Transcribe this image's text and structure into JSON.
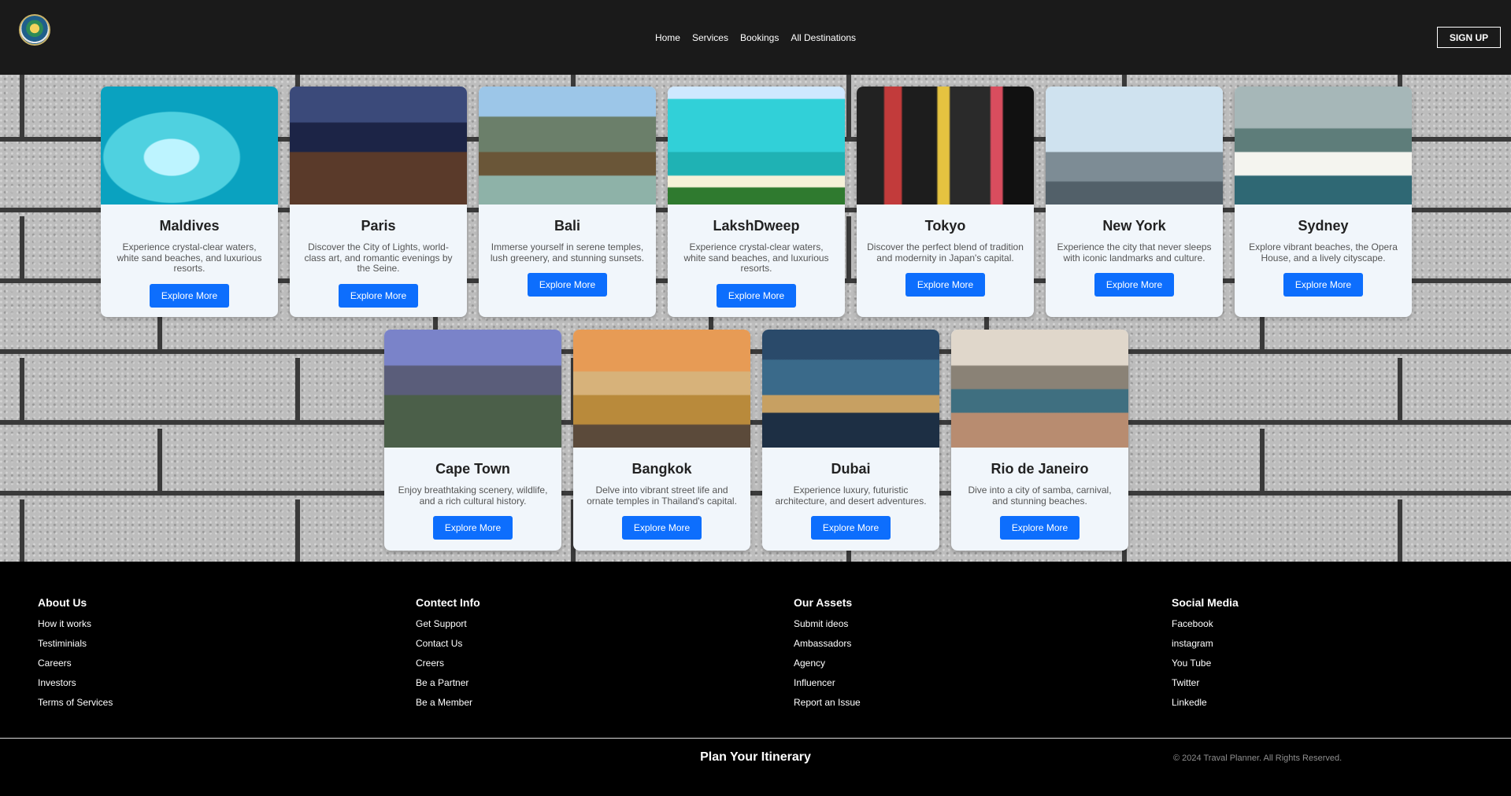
{
  "header": {
    "logo_alt": "logo",
    "nav": [
      "Home",
      "Services",
      "Bookings",
      "All Destinations"
    ],
    "signup": "SIGN UP"
  },
  "destinations": [
    {
      "name": "Maldives",
      "desc": "Experience crystal-clear waters, white sand beaches, and luxurious resorts.",
      "button": "Explore More"
    },
    {
      "name": "Paris",
      "desc": "Discover the City of Lights, world-class art, and romantic evenings by the Seine.",
      "button": "Explore More"
    },
    {
      "name": "Bali",
      "desc": "Immerse yourself in serene temples, lush greenery, and stunning sunsets.",
      "button": "Explore More"
    },
    {
      "name": "LakshDweep",
      "desc": "Experience crystal-clear waters, white sand beaches, and luxurious resorts.",
      "button": "Explore More"
    },
    {
      "name": "Tokyo",
      "desc": "Discover the perfect blend of tradition and modernity in Japan's capital.",
      "button": "Explore More"
    },
    {
      "name": "New York",
      "desc": "Experience the city that never sleeps with iconic landmarks and culture.",
      "button": "Explore More"
    },
    {
      "name": "Sydney",
      "desc": "Explore vibrant beaches, the Opera House, and a lively cityscape.",
      "button": "Explore More"
    },
    {
      "name": "Cape Town",
      "desc": "Enjoy breathtaking scenery, wildlife, and a rich cultural history.",
      "button": "Explore More"
    },
    {
      "name": "Bangkok",
      "desc": "Delve into vibrant street life and ornate temples in Thailand's capital.",
      "button": "Explore More"
    },
    {
      "name": "Dubai",
      "desc": "Experience luxury, futuristic architecture, and desert adventures.",
      "button": "Explore More"
    },
    {
      "name": "Rio de Janeiro",
      "desc": "Dive into a city of samba, carnival, and stunning beaches.",
      "button": "Explore More"
    }
  ],
  "footer": {
    "columns": [
      {
        "title": "About Us",
        "links": [
          "How it works",
          "Testiminials",
          "Careers",
          "Investors",
          "Terms of Services"
        ]
      },
      {
        "title": "Contect Info",
        "links": [
          "Get Support",
          "Contact Us",
          "Creers",
          "Be a Partner",
          "Be a Member"
        ]
      },
      {
        "title": "Our Assets",
        "links": [
          "Submit ideos",
          "Ambassadors",
          "Agency",
          "Influencer",
          "Report an Issue"
        ]
      },
      {
        "title": "Social Media",
        "links": [
          "Facebook",
          "instagram",
          "You Tube",
          "Twitter",
          "Linkedle"
        ]
      }
    ],
    "plan": "Plan Your Itinerary",
    "copyright": "© 2024 Traval Planner. All Rights Reserved."
  },
  "colors": {
    "header_bg": "#1a1a1a",
    "button_blue": "#0d6efd",
    "card_bg": "#f1f6fb",
    "footer_bg": "#000000"
  }
}
